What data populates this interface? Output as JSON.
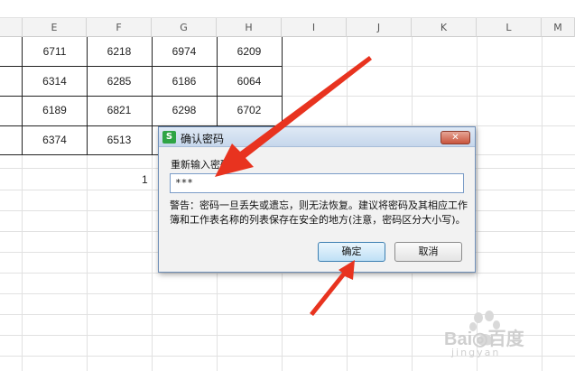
{
  "spreadsheet": {
    "columns": [
      "E",
      "F",
      "G",
      "H",
      "I",
      "J",
      "K",
      "L",
      "M"
    ],
    "rows": [
      [
        "6711",
        "6218",
        "6974",
        "6209"
      ],
      [
        "6314",
        "6285",
        "6186",
        "6064"
      ],
      [
        "6189",
        "6821",
        "6298",
        "6702"
      ],
      [
        "6374",
        "6513",
        "",
        ""
      ]
    ],
    "extra_cell_value": "1"
  },
  "dialog": {
    "title": "确认密码",
    "app_icon_glyph": "S",
    "close_glyph": "✕",
    "password_label": "重新输入密码(R):",
    "password_value": "***",
    "warning_text": "警告：密码一旦丢失或遗忘，则无法恢复。建议将密码及其相应工作簿和工作表名称的列表保存在安全的地方(注意，密码区分大小写)。",
    "ok_label": "确定",
    "cancel_label": "取消"
  },
  "annotation": {
    "arrow_color": "#e8331f"
  },
  "watermark": {
    "brand": "Bai◎百度",
    "sub": "jingyan"
  }
}
